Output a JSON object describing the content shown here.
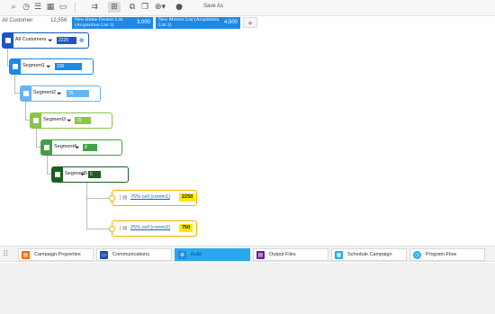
{
  "toolbar": {
    "save_as_label": "Save As",
    "icons": [
      "search-icon",
      "history-icon",
      "list-icon",
      "calendar-icon",
      "comment-icon",
      "align-icon",
      "tree-icon",
      "copy-icon",
      "duplicate-icon",
      "zoom-icon",
      "pin-icon"
    ]
  },
  "lists": {
    "main_label": "All Customer",
    "main_count": "12,556",
    "tabs": [
      {
        "name": "New Home Owners List (Acquisition List 1)",
        "count": "3,000"
      },
      {
        "name": "New Movers List (Acquisition List 2)",
        "count": "4,500"
      }
    ],
    "add_label": "+"
  },
  "tree": {
    "segments": [
      {
        "label": "All Customers",
        "count": "2225",
        "color": "#1a56c4",
        "extra": "⊕"
      },
      {
        "label": "Segment1",
        "count": "100",
        "color": "#1e88e5"
      },
      {
        "label": "Segment2",
        "count": "25",
        "color": "#64b5f6"
      },
      {
        "label": "Segment3",
        "count": "15",
        "color": "#8bc34a"
      },
      {
        "label": "Segment4",
        "count": "8",
        "color": "#43a047"
      },
      {
        "label": "Segment5",
        "count": "5",
        "color": "#1b5e20"
      }
    ],
    "cells": [
      {
        "label": "75% cell (comm1)",
        "count": "2250"
      },
      {
        "label": "25% cell (comm2)",
        "count": "750"
      }
    ]
  },
  "bottom_nav": [
    {
      "label": "Campaign Properties",
      "icon_color": "#ef6c00",
      "active": false
    },
    {
      "label": "Communications",
      "icon_color": "#1e4fb0",
      "active": false
    },
    {
      "label": "Build",
      "icon_color": "#1e88e5",
      "active": true
    },
    {
      "label": "Output Files",
      "icon_color": "#6a1b9a",
      "active": false
    },
    {
      "label": "Schedule Campaign",
      "icon_color": "#29a8ef",
      "active": false
    },
    {
      "label": "Program Flow",
      "icon_color": "#29a8ef",
      "active": false
    }
  ],
  "colors": {
    "accent": "#1e88e5",
    "cell_border": "#f0b400",
    "badge": "#fde800"
  }
}
